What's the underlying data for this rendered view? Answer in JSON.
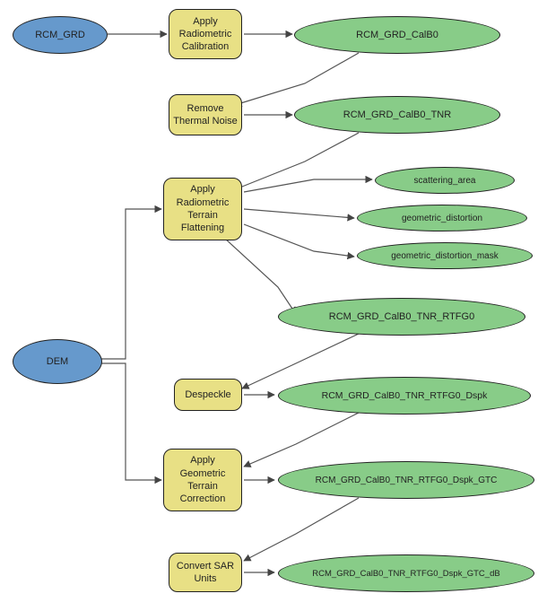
{
  "inputs": {
    "rcm_grd": "RCM_GRD",
    "dem": "DEM"
  },
  "steps": {
    "s1": "Apply\nRadiometric\nCalibration",
    "s2": "Remove\nThermal Noise",
    "s3": "Apply\nRadiometric\nTerrain\nFlattening",
    "s4": "Despeckle",
    "s5": "Apply\nGeometric\nTerrain\nCorrection",
    "s6": "Convert SAR\nUnits"
  },
  "outputs": {
    "o1": "RCM_GRD_CalB0",
    "o2": "RCM_GRD_CalB0_TNR",
    "o3a": "scattering_area",
    "o3b": "geometric_distortion",
    "o3c": "geometric_distortion_mask",
    "o4": "RCM_GRD_CalB0_TNR_RTFG0",
    "o5": "RCM_GRD_CalB0_TNR_RTFG0_Dspk",
    "o6": "RCM_GRD_CalB0_TNR_RTFG0_Dspk_GTC",
    "o7": "RCM_GRD_CalB0_TNR_RTFG0_Dspk_GTC_dB"
  },
  "chart_data": {
    "type": "diagram",
    "title": "",
    "nodes": {
      "inputs": [
        "RCM_GRD",
        "DEM"
      ],
      "processes": [
        "Apply Radiometric Calibration",
        "Remove Thermal Noise",
        "Apply Radiometric Terrain Flattening",
        "Despeckle",
        "Apply Geometric Terrain Correction",
        "Convert SAR Units"
      ],
      "outputs": [
        "RCM_GRD_CalB0",
        "RCM_GRD_CalB0_TNR",
        "scattering_area",
        "geometric_distortion",
        "geometric_distortion_mask",
        "RCM_GRD_CalB0_TNR_RTFG0",
        "RCM_GRD_CalB0_TNR_RTFG0_Dspk",
        "RCM_GRD_CalB0_TNR_RTFG0_Dspk_GTC",
        "RCM_GRD_CalB0_TNR_RTFG0_Dspk_GTC_dB"
      ]
    },
    "edges": [
      [
        "RCM_GRD",
        "Apply Radiometric Calibration"
      ],
      [
        "Apply Radiometric Calibration",
        "RCM_GRD_CalB0"
      ],
      [
        "RCM_GRD_CalB0",
        "Remove Thermal Noise"
      ],
      [
        "Remove Thermal Noise",
        "RCM_GRD_CalB0_TNR"
      ],
      [
        "RCM_GRD_CalB0_TNR",
        "Apply Radiometric Terrain Flattening"
      ],
      [
        "DEM",
        "Apply Radiometric Terrain Flattening"
      ],
      [
        "DEM",
        "Apply Geometric Terrain Correction"
      ],
      [
        "Apply Radiometric Terrain Flattening",
        "scattering_area"
      ],
      [
        "Apply Radiometric Terrain Flattening",
        "geometric_distortion"
      ],
      [
        "Apply Radiometric Terrain Flattening",
        "geometric_distortion_mask"
      ],
      [
        "Apply Radiometric Terrain Flattening",
        "RCM_GRD_CalB0_TNR_RTFG0"
      ],
      [
        "RCM_GRD_CalB0_TNR_RTFG0",
        "Despeckle"
      ],
      [
        "Despeckle",
        "RCM_GRD_CalB0_TNR_RTFG0_Dspk"
      ],
      [
        "RCM_GRD_CalB0_TNR_RTFG0_Dspk",
        "Apply Geometric Terrain Correction"
      ],
      [
        "Apply Geometric Terrain Correction",
        "RCM_GRD_CalB0_TNR_RTFG0_Dspk_GTC"
      ],
      [
        "RCM_GRD_CalB0_TNR_RTFG0_Dspk_GTC",
        "Convert SAR Units"
      ],
      [
        "Convert SAR Units",
        "RCM_GRD_CalB0_TNR_RTFG0_Dspk_GTC_dB"
      ]
    ]
  }
}
